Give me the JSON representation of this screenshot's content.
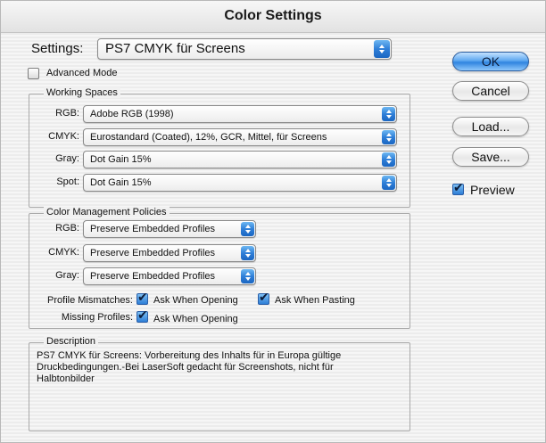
{
  "window": {
    "title": "Color Settings"
  },
  "settings": {
    "label": "Settings:",
    "value": "PS7 CMYK für Screens"
  },
  "advanced_mode": {
    "label": "Advanced Mode",
    "checked": false
  },
  "working_spaces": {
    "title": "Working Spaces",
    "rows": [
      {
        "label": "RGB:",
        "value": "Adobe RGB (1998)"
      },
      {
        "label": "CMYK:",
        "value": "Eurostandard (Coated), 12%, GCR, Mittel, für Screens"
      },
      {
        "label": "Gray:",
        "value": "Dot Gain 15%"
      },
      {
        "label": "Spot:",
        "value": "Dot Gain 15%"
      }
    ]
  },
  "policies": {
    "title": "Color Management Policies",
    "rows": [
      {
        "label": "RGB:",
        "value": "Preserve Embedded Profiles"
      },
      {
        "label": "CMYK:",
        "value": "Preserve Embedded Profiles"
      },
      {
        "label": "Gray:",
        "value": "Preserve Embedded Profiles"
      }
    ],
    "profile_mismatches": {
      "label": "Profile Mismatches:",
      "ask_opening": {
        "label": "Ask When Opening",
        "checked": true
      },
      "ask_pasting": {
        "label": "Ask When Pasting",
        "checked": true
      }
    },
    "missing_profiles": {
      "label": "Missing Profiles:",
      "ask_opening": {
        "label": "Ask When Opening",
        "checked": true
      }
    }
  },
  "description": {
    "title": "Description",
    "lines": [
      "PS7 CMYK für Screens:  Vorbereitung des Inhalts für in Europa gültige",
      "Druckbedingungen.-Bei LaserSoft gedacht für Screenshots, nicht für",
      "Halbtonbilder"
    ]
  },
  "buttons": {
    "ok": "OK",
    "cancel": "Cancel",
    "load": "Load...",
    "save": "Save..."
  },
  "preview": {
    "label": "Preview",
    "checked": true
  },
  "colors": {
    "accent": "#2f84e0",
    "popup_arrow": "#2f7fd8"
  }
}
